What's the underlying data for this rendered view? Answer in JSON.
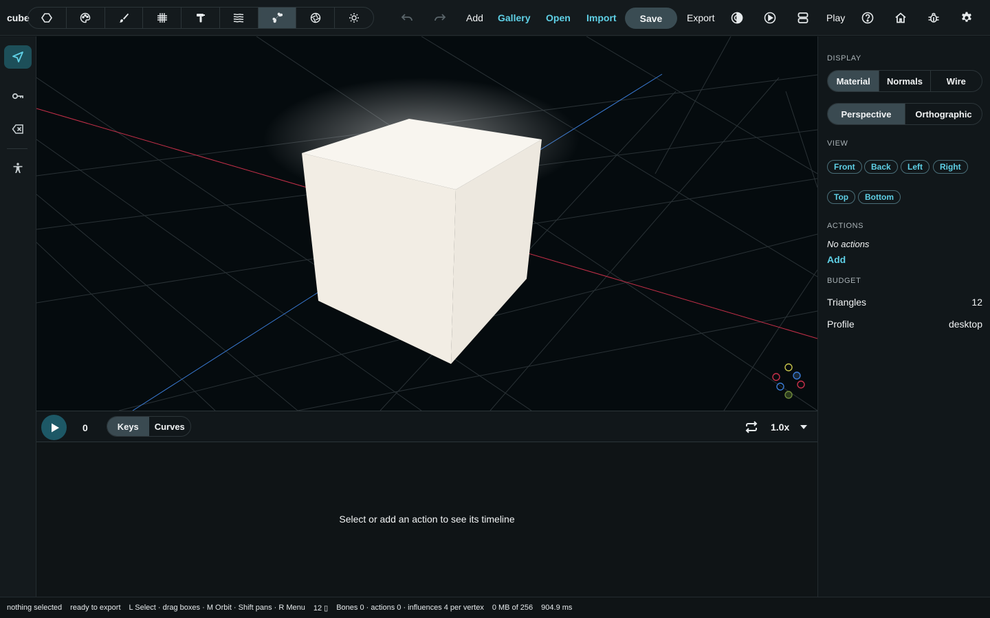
{
  "project": {
    "name": "cube"
  },
  "toolbar": {
    "tools": [
      {
        "name": "shape-tool",
        "icon": "hexagon-icon"
      },
      {
        "name": "paint-tool",
        "icon": "palette-icon"
      },
      {
        "name": "brush-tool",
        "icon": "brush-icon"
      },
      {
        "name": "grid-tool",
        "icon": "grid-icon"
      },
      {
        "name": "hammer-tool",
        "icon": "hammer-icon"
      },
      {
        "name": "layers-tool",
        "icon": "waves-icon"
      },
      {
        "name": "bone-tool",
        "icon": "bone-icon",
        "active": true
      },
      {
        "name": "material-tool",
        "icon": "aperture-icon"
      },
      {
        "name": "light-tool",
        "icon": "sun-icon"
      }
    ],
    "add_label": "Add",
    "gallery_label": "Gallery",
    "open_label": "Open",
    "import_label": "Import",
    "save_label": "Save",
    "export_label": "Export",
    "play_label": "Play"
  },
  "viewport": {
    "background_color": "#050b0e",
    "cube_color": "#f4efe6",
    "x_axis_color": "#c9304a",
    "z_axis_color": "#3a7bd5"
  },
  "timeline": {
    "frame": "0",
    "modes": [
      "Keys",
      "Curves"
    ],
    "active_mode": "Keys",
    "speed": "1.0x",
    "empty_message": "Select or add an action to see its timeline"
  },
  "panel": {
    "display_label": "DISPLAY",
    "display_modes": [
      "Material",
      "Normals",
      "Wire"
    ],
    "active_display": "Material",
    "projections": [
      "Perspective",
      "Orthographic"
    ],
    "active_projection": "Perspective",
    "view_label": "VIEW",
    "views_row1": [
      "Front",
      "Back",
      "Left",
      "Right"
    ],
    "views_row2": [
      "Top",
      "Bottom"
    ],
    "actions_label": "ACTIONS",
    "no_actions": "No actions",
    "add_action": "Add",
    "budget_label": "BUDGET",
    "triangles_label": "Triangles",
    "triangles_value": "12",
    "profile_label": "Profile",
    "profile_value": "desktop"
  },
  "status": {
    "selection": "nothing selected",
    "export_state": "ready to export",
    "hints": "L Select · drag boxes · M Orbit · Shift pans · R Menu",
    "tri_count": "12 ▯",
    "bones": "Bones 0 · actions 0 · influences 4 per vertex",
    "memory": "0 MB of 256",
    "frame_time": "904.9 ms"
  },
  "accent_color": "#5fd0e6"
}
